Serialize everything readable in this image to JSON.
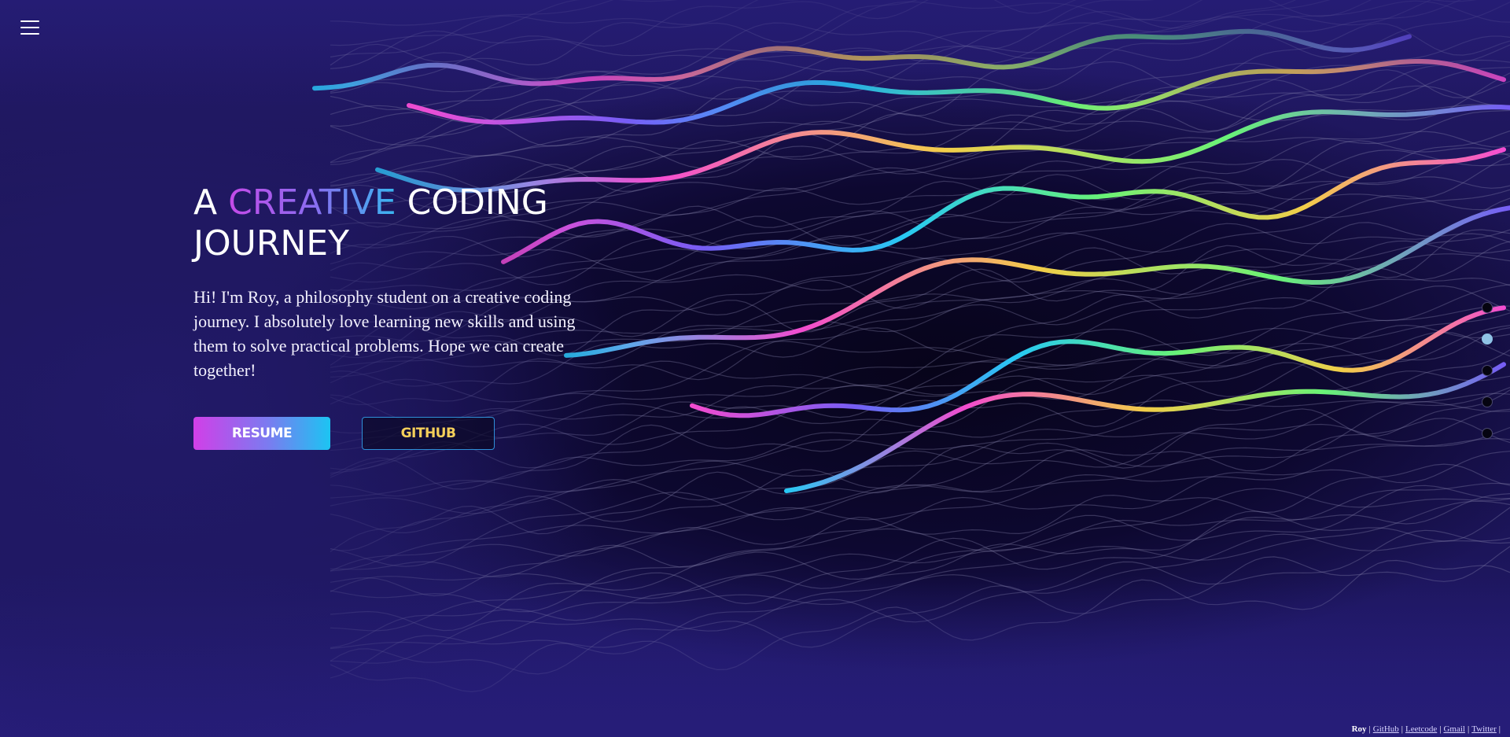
{
  "nav": {
    "menu_icon": "hamburger-menu-icon"
  },
  "hero": {
    "title_prefix": "A ",
    "title_accent": "CREATIVE",
    "title_suffix": " CODING JOURNEY",
    "intro": "Hi! I'm Roy, a philosophy student on a creative coding journey. I absolutely love learning new skills and using them to solve practical problems. Hope we can create together!",
    "resume_label": "RESUME",
    "github_label": "GITHUB"
  },
  "section_dots": {
    "count": 5,
    "active_index": 1
  },
  "footer": {
    "owner": "Roy",
    "links": [
      "GitHub",
      "Leetcode",
      "Gmail",
      "Twitter"
    ]
  },
  "colors": {
    "background": "#241b6b",
    "accent_gradient_start": "#c54ae8",
    "accent_gradient_end": "#38b6f0",
    "github_text": "#f4cf5a",
    "github_border": "#2f8fd8",
    "active_dot": "#8fc3e6"
  }
}
